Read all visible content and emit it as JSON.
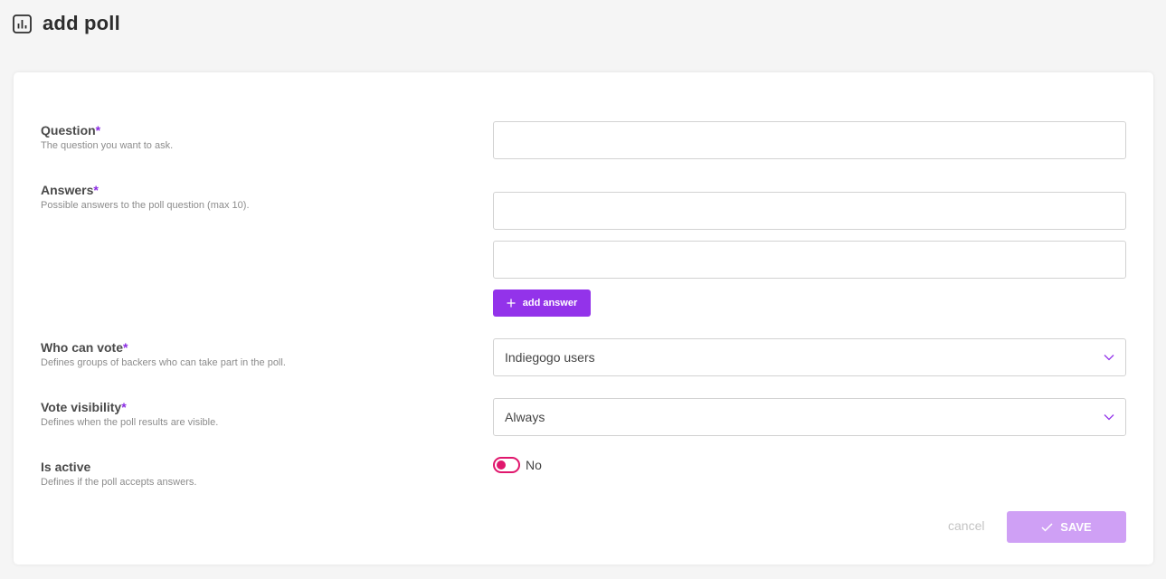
{
  "page": {
    "title": "add poll",
    "title_icon": "bar-chart-icon"
  },
  "form": {
    "required_marker": "*",
    "question": {
      "label": "Question",
      "hint": "The question you want to ask.",
      "value": ""
    },
    "answers": {
      "label": "Answers",
      "hint": "Possible answers to the poll question (max 10).",
      "items": [
        "",
        ""
      ],
      "add_label": "add answer",
      "add_icon": "plus-icon"
    },
    "who_can_vote": {
      "label": "Who can vote",
      "hint": "Defines groups of backers who can take part in the poll.",
      "selected": "Indiegogo users",
      "icon": "chevron-down-icon"
    },
    "vote_visibility": {
      "label": "Vote visibility",
      "hint": "Defines when the poll results are visible.",
      "selected": "Always",
      "icon": "chevron-down-icon"
    },
    "is_active": {
      "label": "Is active",
      "hint": "Defines if the poll accepts answers.",
      "state_label": "No",
      "checked": false
    }
  },
  "actions": {
    "cancel_label": "cancel",
    "save_label": "SAVE",
    "save_icon": "check-icon"
  },
  "colors": {
    "accent": "#9333ea",
    "required": "#8a2be2",
    "toggle": "#e0176d",
    "save_disabled": "#cfa0f5"
  }
}
